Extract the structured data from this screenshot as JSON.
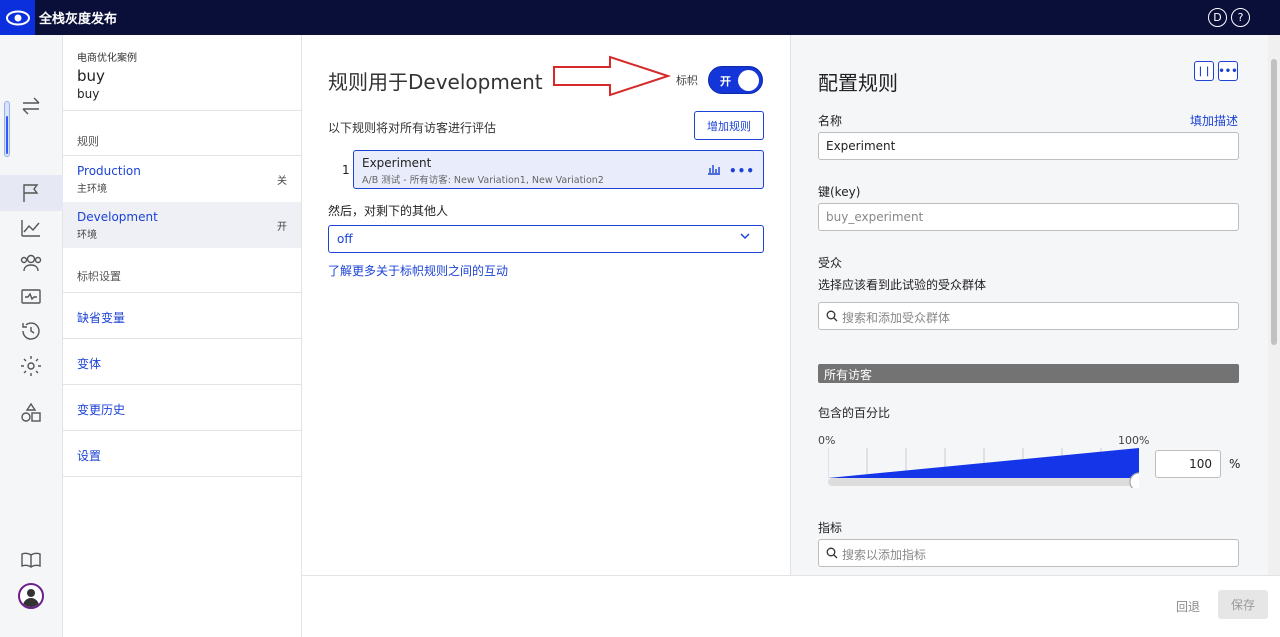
{
  "app": {
    "title": "全栈灰度发布"
  },
  "header": {
    "doc_icon": "D",
    "help_icon": "?"
  },
  "project": {
    "category": "电商优化案例",
    "name": "buy",
    "key": "buy"
  },
  "nav": {
    "rules_heading": "规则",
    "envs": [
      {
        "name": "Production",
        "desc": "主环境",
        "state": "关"
      },
      {
        "name": "Development",
        "desc": "环境",
        "state": "开"
      }
    ],
    "settings_heading": "标帜设置",
    "links": [
      "缺省变量",
      "变体",
      "变更历史",
      "设置"
    ]
  },
  "main": {
    "title": "规则用于Development",
    "toggle_label": "标帜",
    "toggle_state": "开",
    "desc": "以下规则将对所有访客进行评估",
    "add_rule": "增加规则",
    "rule_index": "1",
    "rule_title": "Experiment",
    "rule_sub": "A/B 测试 - 所有访客: New Variation1, New Variation2",
    "then_label": "然后，对剩下的其他人",
    "fallback": "off",
    "learn_more": "了解更多关于标帜规则之间的互动"
  },
  "panel": {
    "title": "配置规则",
    "name_label": "名称",
    "add_desc": "填加描述",
    "name_value": "Experiment",
    "key_label": "键(key)",
    "key_placeholder": "buy_experiment",
    "audience_label": "受众",
    "audience_hint": "选择应该看到此试验的受众群体",
    "audience_placeholder": "搜索和添加受众群体",
    "all_visitors": "所有访客",
    "pct_label": "包含的百分比",
    "pct_min": "0%",
    "pct_max": "100%",
    "pct_value": "100",
    "pct_sign": "%",
    "metrics_label": "指标",
    "metrics_placeholder": "搜索以添加指标"
  },
  "footer": {
    "back": "回退",
    "save": "保存"
  },
  "colors": {
    "primary": "#1c43d6",
    "topbar": "#0a0f3a",
    "arrow": "#d62a2a"
  },
  "slider_fraction": 1.0
}
